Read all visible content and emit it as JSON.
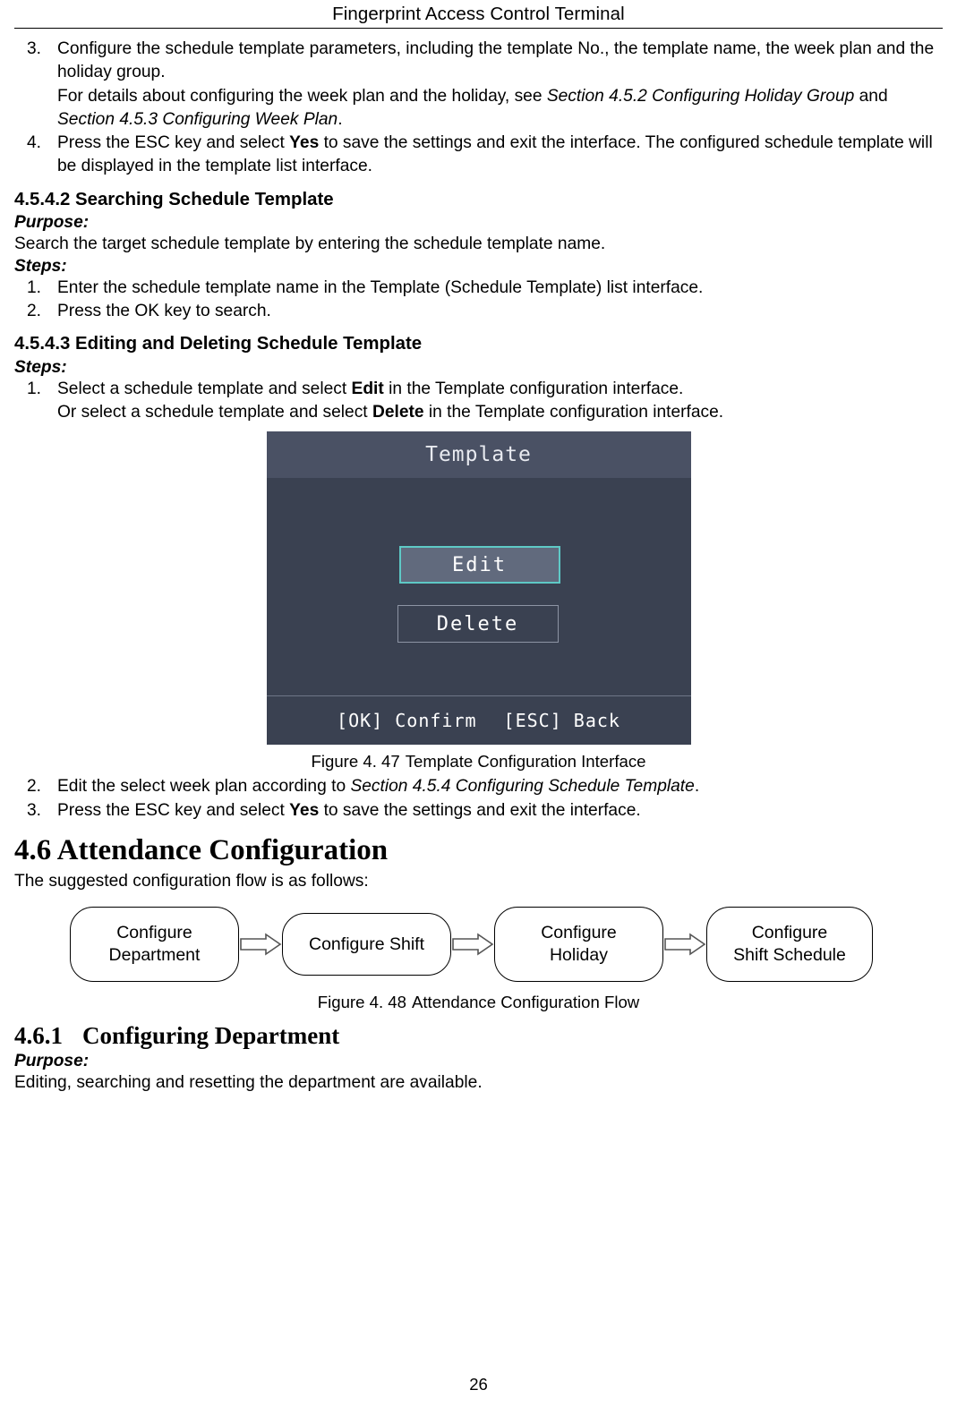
{
  "header": {
    "title": "Fingerprint Access Control Terminal"
  },
  "list_top": [
    {
      "num": "3.",
      "line1": "Configure the schedule template parameters, including the template No., the template name, the week plan and the holiday group.",
      "line2_pre": "For details about configuring the week plan and the holiday, see ",
      "line2_it1": "Section 4.5.2 Configuring Holiday Group",
      "line2_mid": " and ",
      "line2_it2": "Section 4.5.3 Configuring Week Plan",
      "line2_post": "."
    },
    {
      "num": "4.",
      "pre": "Press the ESC key and select ",
      "bold": "Yes",
      "post": " to save the settings and exit the interface. The configured schedule template will be displayed in the template list interface."
    }
  ],
  "section_searching": {
    "heading": "4.5.4.2 Searching Schedule Template",
    "purpose_label": "Purpose:",
    "purpose_text": "Search the target schedule template by entering the schedule template name.",
    "steps_label": "Steps:",
    "steps": [
      {
        "num": "1.",
        "text": "Enter the schedule template name in the Template (Schedule Template) list interface."
      },
      {
        "num": "2.",
        "text": "Press the OK key to search."
      }
    ]
  },
  "section_editing": {
    "heading": "4.5.4.3 Editing and Deleting Schedule Template",
    "steps_label": "Steps:",
    "step1": {
      "num": "1.",
      "line1_pre": "Select a schedule template and select ",
      "line1_bold": "Edit",
      "line1_post": " in the Template configuration interface.",
      "line2_pre": "Or select a schedule template and select ",
      "line2_bold": "Delete",
      "line2_post": " in the Template configuration interface."
    },
    "step2": {
      "num": "2.",
      "pre": "Edit the select week plan according to ",
      "italic": "Section 4.5.4 Configuring Schedule Template",
      "post": "."
    },
    "step3": {
      "num": "3.",
      "pre": "Press the ESC key and select ",
      "bold": "Yes",
      "post": " to save the settings and exit the interface."
    }
  },
  "device_screen": {
    "title": "Template",
    "edit_button": "Edit",
    "delete_button": "Delete",
    "footer_ok": "[OK] Confirm",
    "footer_esc": "[ESC] Back"
  },
  "figure_47": {
    "number": "Figure 4. 47",
    "caption": "Template Configuration Interface"
  },
  "chapter_46": {
    "heading": "4.6 Attendance Configuration",
    "intro": "The suggested configuration flow is as follows:"
  },
  "flow_diagram": {
    "boxes": [
      "Configure\nDepartment",
      "Configure Shift",
      "Configure\nHoliday",
      "Configure\nShift Schedule"
    ]
  },
  "figure_48": {
    "number": "Figure 4. 48",
    "caption": "Attendance Configuration Flow"
  },
  "section_461": {
    "number": "4.6.1",
    "heading": "Configuring Department",
    "purpose_label": "Purpose:",
    "purpose_text": "Editing, searching and resetting the department are available."
  },
  "footer": {
    "page_number": "26"
  }
}
